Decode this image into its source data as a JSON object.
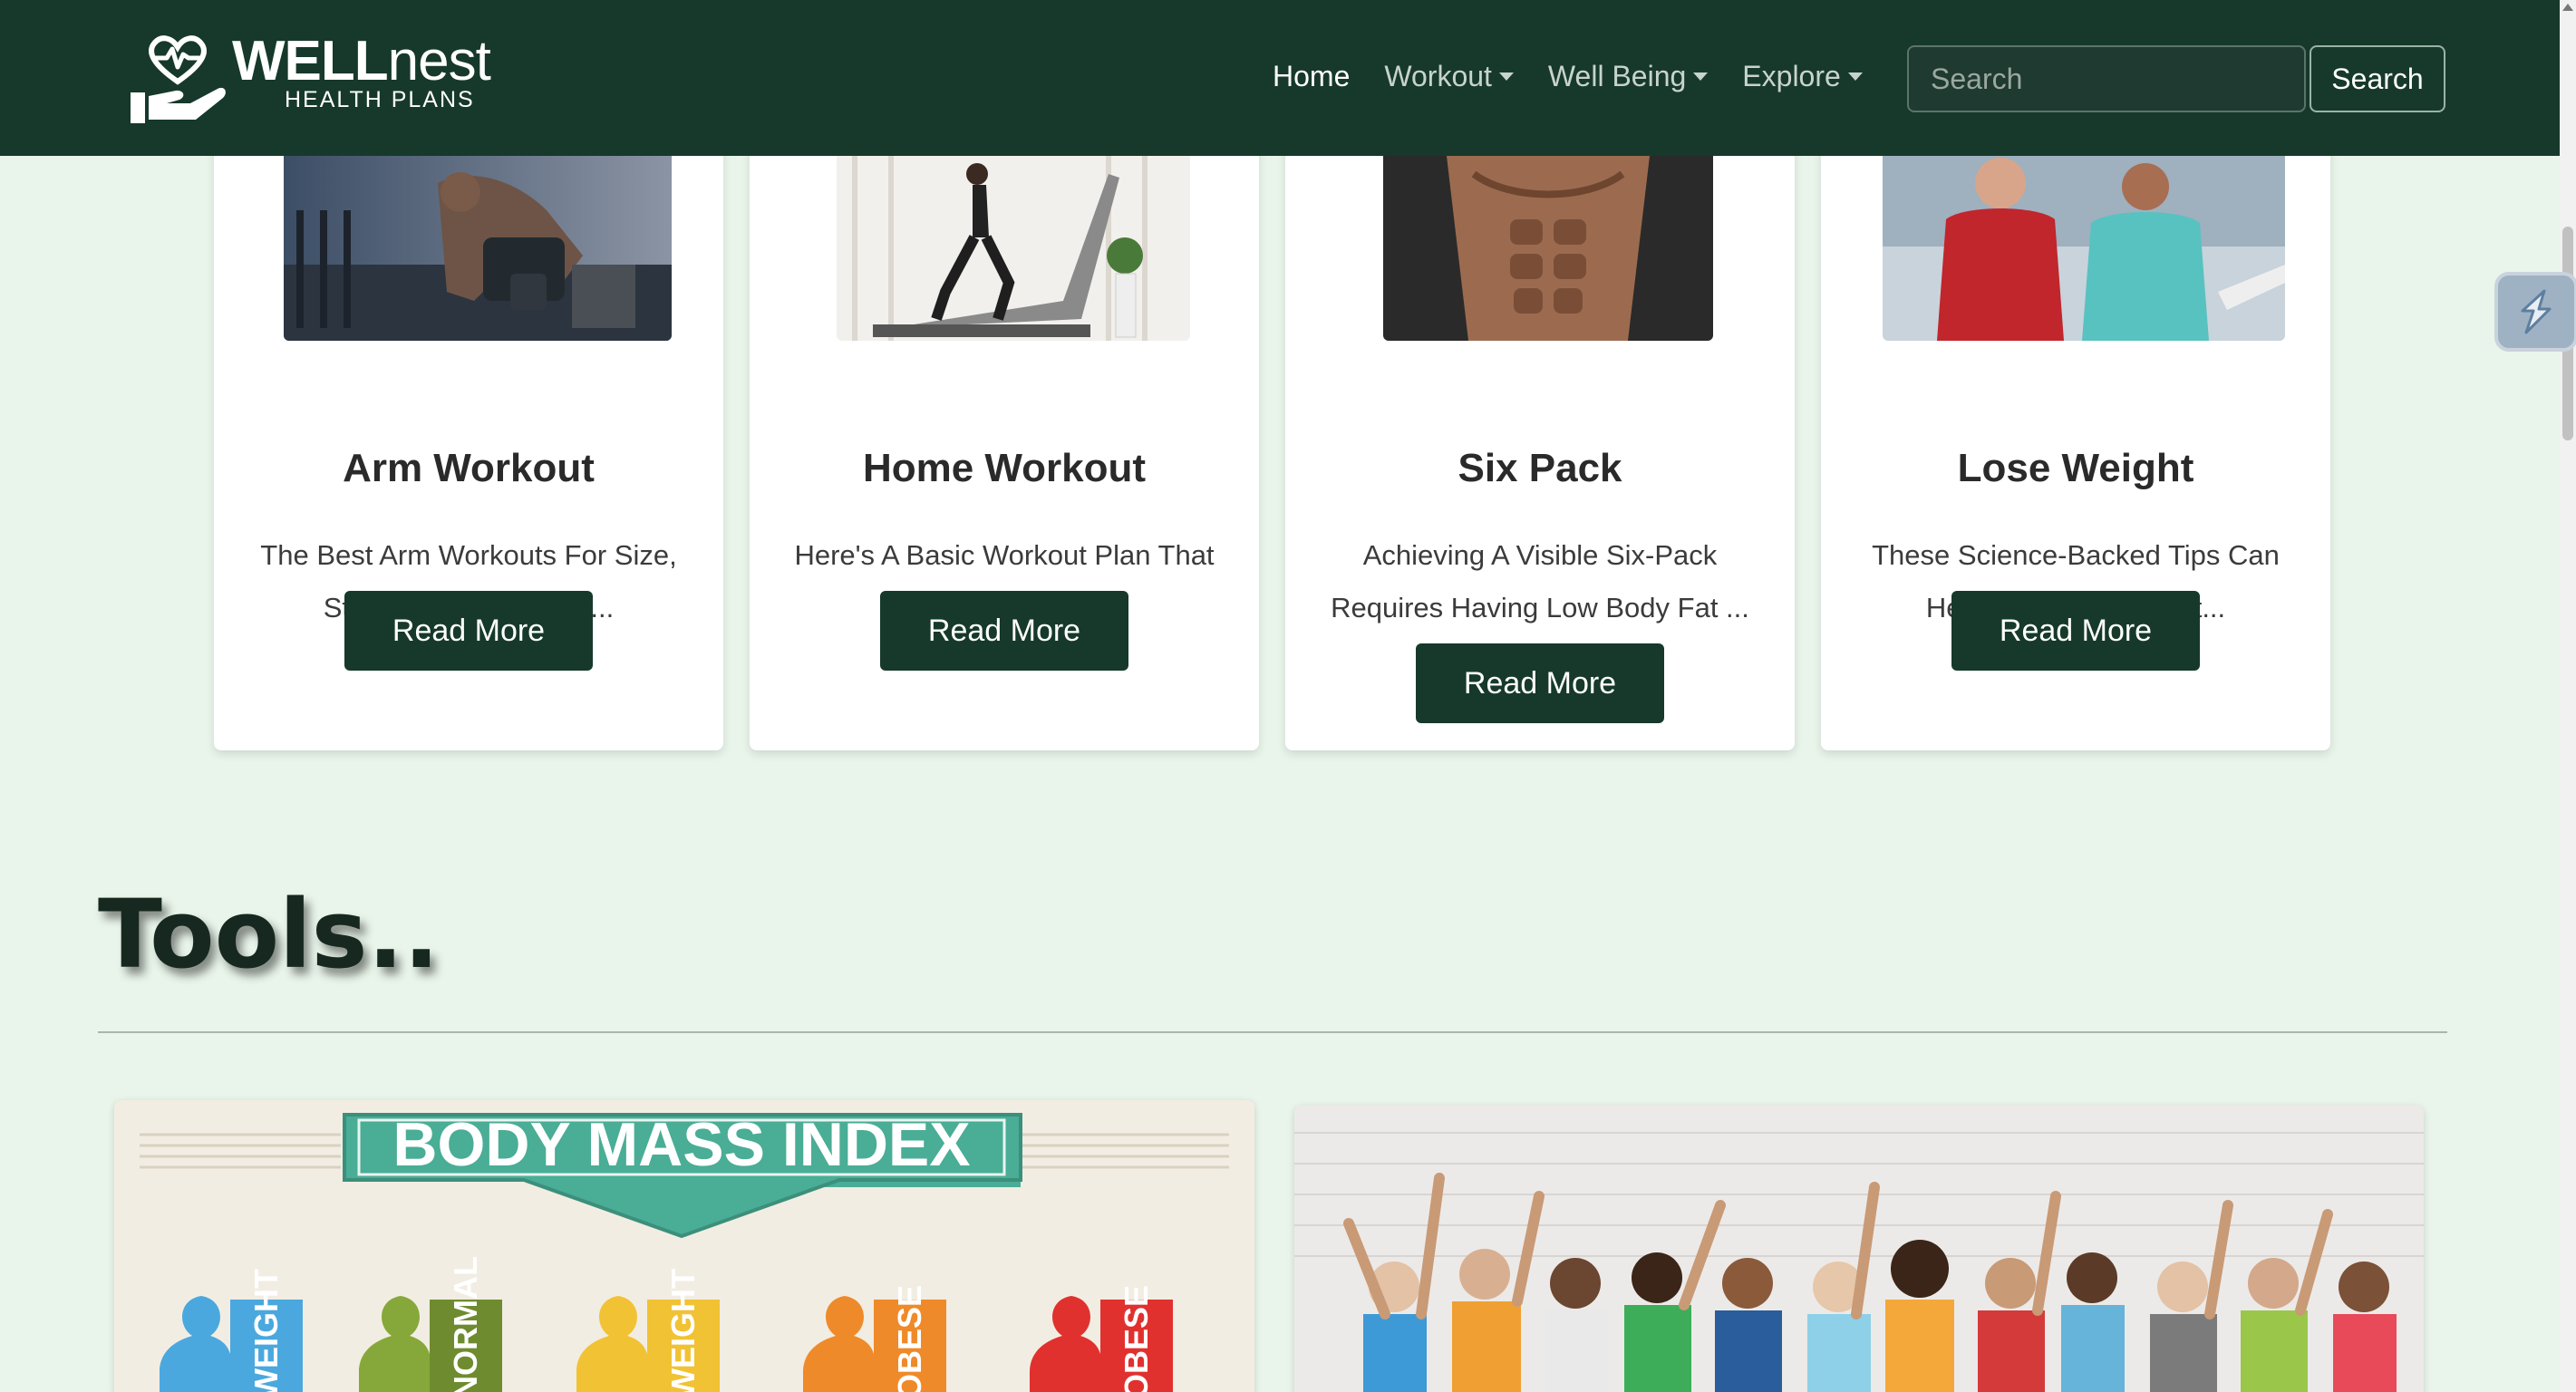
{
  "brand": {
    "name_bold": "WELL",
    "name_light": "nest",
    "tagline": "HEALTH PLANS"
  },
  "nav": {
    "items": [
      {
        "label": "Home",
        "active": true,
        "dropdown": false
      },
      {
        "label": "Workout",
        "active": false,
        "dropdown": true
      },
      {
        "label": "Well Being",
        "active": false,
        "dropdown": true
      },
      {
        "label": "Explore",
        "active": false,
        "dropdown": true
      }
    ],
    "search_placeholder": "Search",
    "search_button": "Search"
  },
  "cards": [
    {
      "title": "Arm Workout",
      "text": "The Best Arm Workouts For Size, Strength & Beginners...",
      "button": "Read More",
      "image": "man-lifting-dumbbell-in-gym"
    },
    {
      "title": "Home Workout",
      "text": "Here's A Basic Workout Plan That You Can Follow:",
      "button": "Read More",
      "image": "woman-running-on-treadmill"
    },
    {
      "title": "Six Pack",
      "text": "Achieving A Visible Six-Pack Requires Having Low Body Fat ...",
      "button": "Read More",
      "image": "muscular-torso"
    },
    {
      "title": "Lose Weight",
      "text": "These Science-Backed Tips Can Help You Lose Weight...",
      "button": "Read More",
      "image": "two-people-jogging"
    }
  ],
  "tools": {
    "heading": "Tools..",
    "bmi": {
      "title": "BODY MASS INDEX",
      "categories": [
        "WEIGHT",
        "NORMAL",
        "WEIGHT",
        "OBESE",
        "OBESE"
      ],
      "colors": [
        "#4aa8df",
        "#86a83a",
        "#f1c233",
        "#ef8a2a",
        "#e0312f"
      ]
    },
    "crowd_image": "cheering-diverse-crowd"
  },
  "colors": {
    "brand_dark": "#16392b",
    "page_bg": "#e9f5ea"
  }
}
